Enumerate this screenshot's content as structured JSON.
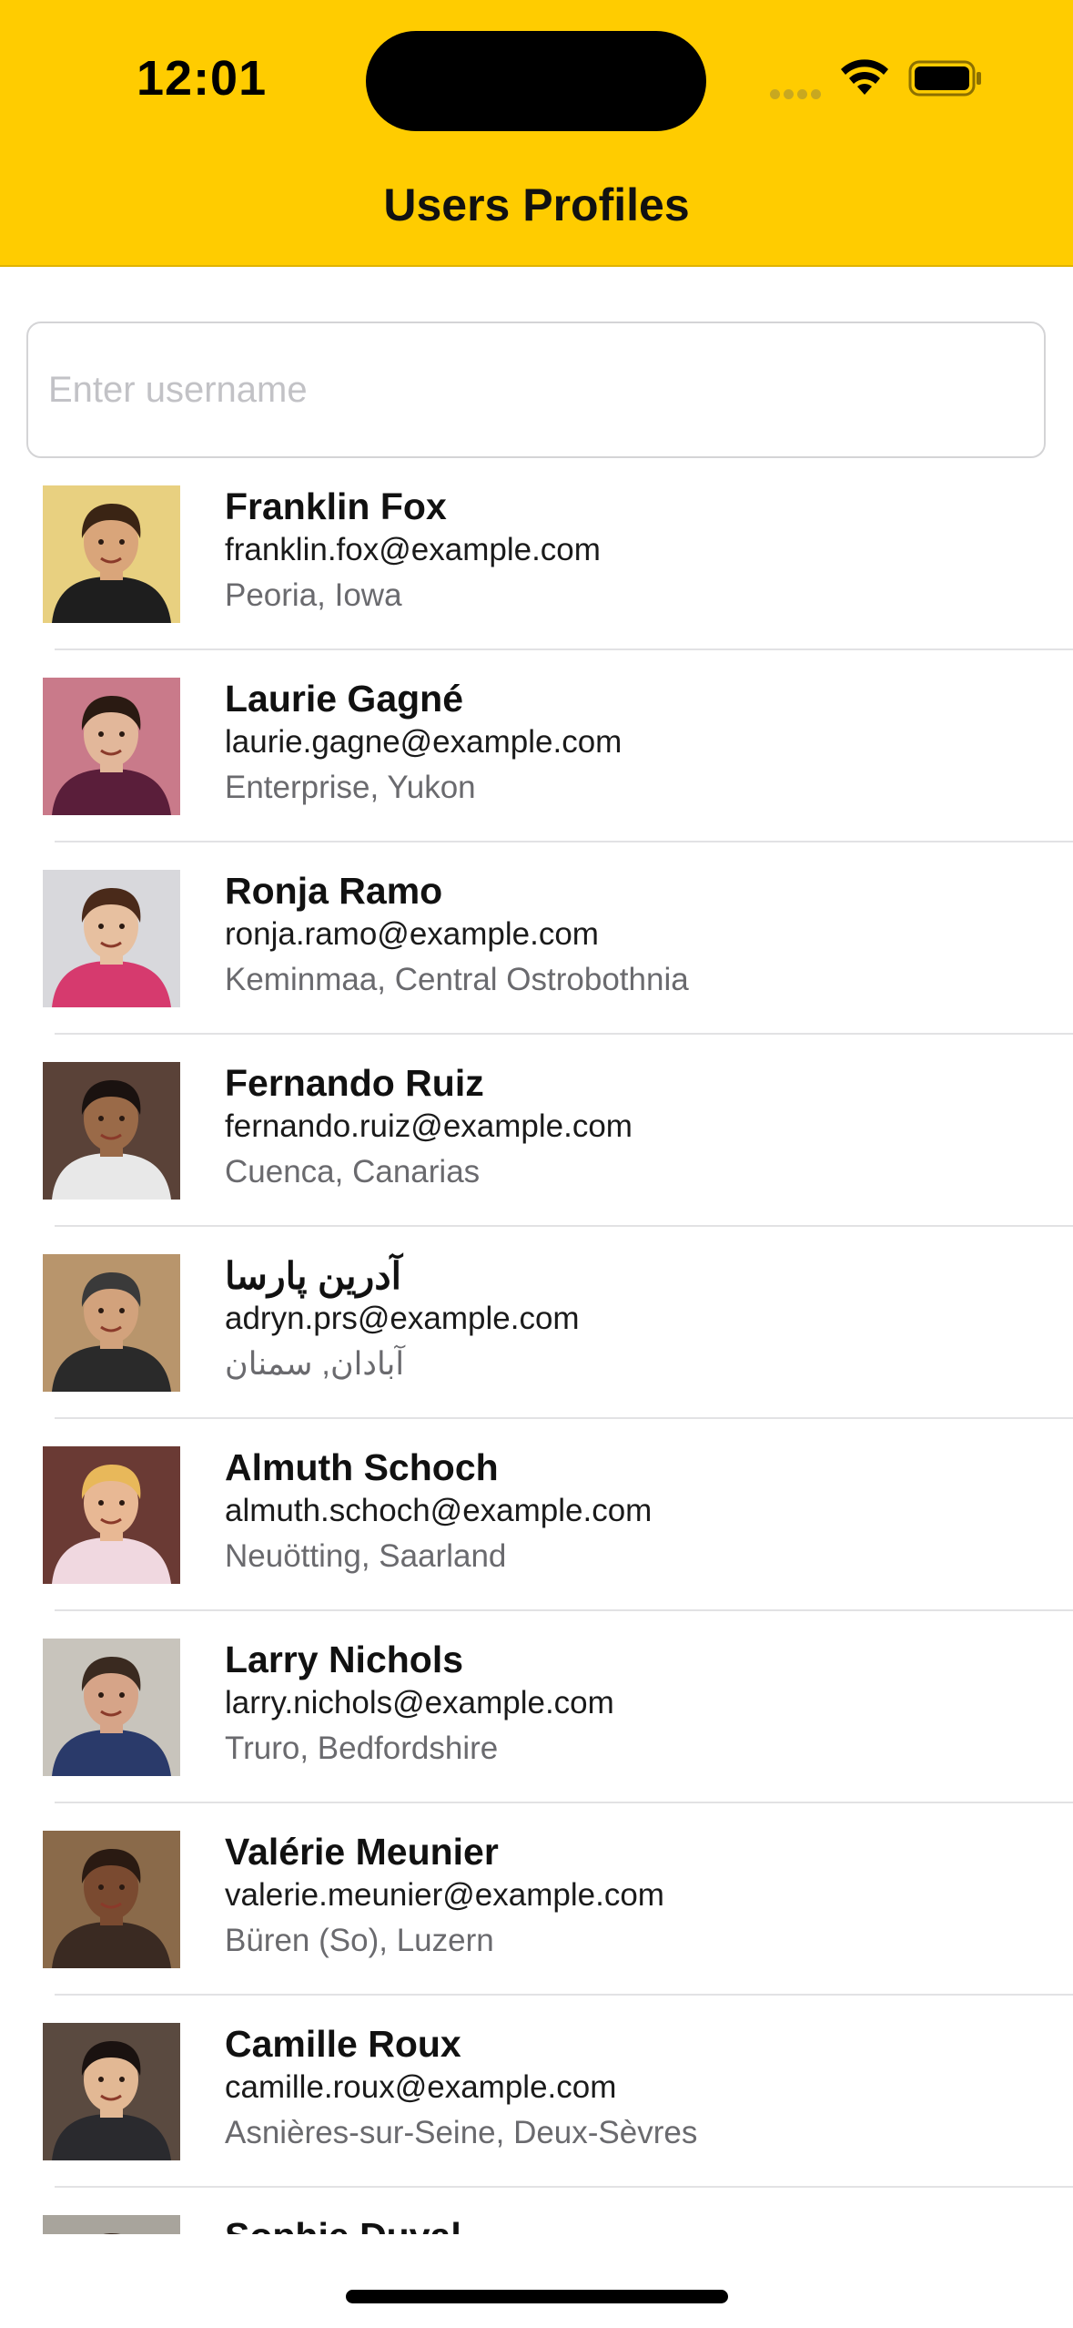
{
  "status_bar": {
    "time": "12:01",
    "icons": [
      "cellular-dots-icon",
      "wifi-icon",
      "battery-icon"
    ]
  },
  "nav": {
    "title": "Users Profiles"
  },
  "search": {
    "placeholder": "Enter username",
    "value": ""
  },
  "theme": {
    "header_bg": "#FFCC00",
    "separator": "#E2E2E4",
    "secondary_text": "#6A6A6E"
  },
  "users": [
    {
      "name": "Franklin Fox",
      "email": "franklin.fox@example.com",
      "location": "Peoria, Iowa",
      "avatar": {
        "bg": "#E8D080",
        "skin": "#D9A57A",
        "hair": "#3A2414",
        "shirt": "#1E1E1E"
      }
    },
    {
      "name": "Laurie Gagné",
      "email": "laurie.gagne@example.com",
      "location": "Enterprise, Yukon",
      "avatar": {
        "bg": "#C97A8A",
        "skin": "#E2B79A",
        "hair": "#2A1A12",
        "shirt": "#5A1E3A"
      }
    },
    {
      "name": "Ronja Ramo",
      "email": "ronja.ramo@example.com",
      "location": "Keminmaa, Central Ostrobothnia",
      "avatar": {
        "bg": "#D8D8DC",
        "skin": "#E7C0A0",
        "hair": "#4A2A1A",
        "shirt": "#D63A6E"
      }
    },
    {
      "name": "Fernando Ruiz",
      "email": "fernando.ruiz@example.com",
      "location": "Cuenca, Canarias",
      "avatar": {
        "bg": "#5A4238",
        "skin": "#9A6A48",
        "hair": "#1A1210",
        "shirt": "#E8E8E8"
      }
    },
    {
      "name": "آدرین پارسا",
      "email": "adryn.prs@example.com",
      "location": "آبادان, سمنان",
      "avatar": {
        "bg": "#B8956C",
        "skin": "#D2A27C",
        "hair": "#3A3A3A",
        "shirt": "#2A2A2A"
      }
    },
    {
      "name": "Almuth Schoch",
      "email": "almuth.schoch@example.com",
      "location": "Neuötting, Saarland",
      "avatar": {
        "bg": "#6A3A34",
        "skin": "#E8B894",
        "hair": "#E8B85A",
        "shirt": "#F0D8E0"
      }
    },
    {
      "name": "Larry Nichols",
      "email": "larry.nichols@example.com",
      "location": "Truro, Bedfordshire",
      "avatar": {
        "bg": "#C8C4BC",
        "skin": "#D6A488",
        "hair": "#3A2A20",
        "shirt": "#2A3A6A"
      }
    },
    {
      "name": "Valérie Meunier",
      "email": "valerie.meunier@example.com",
      "location": "Büren (So), Luzern",
      "avatar": {
        "bg": "#8A6A4A",
        "skin": "#7A4A30",
        "hair": "#2A1A12",
        "shirt": "#3A2A22"
      }
    },
    {
      "name": "Camille Roux",
      "email": "camille.roux@example.com",
      "location": "Asnières-sur-Seine, Deux-Sèvres",
      "avatar": {
        "bg": "#5A4A40",
        "skin": "#E2B894",
        "hair": "#1A1210",
        "shirt": "#2A2A2E"
      }
    },
    {
      "name": "Sophie Duval",
      "email": "",
      "location": "",
      "avatar": {
        "bg": "#A8A49C",
        "skin": "#D8B090",
        "hair": "#3A2A20",
        "shirt": "#4A4A4A"
      }
    }
  ]
}
